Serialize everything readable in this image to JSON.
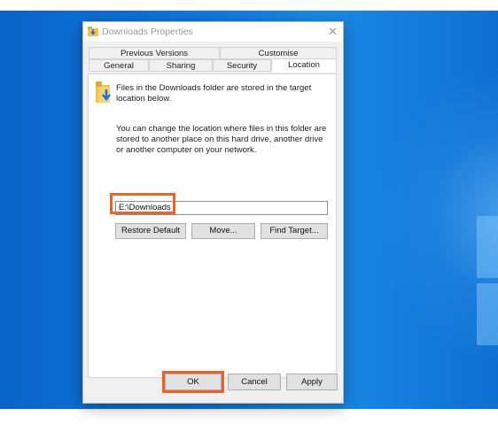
{
  "window": {
    "title": "Downloads Properties",
    "close_glyph": "✕"
  },
  "tabs": {
    "row1": [
      "Previous Versions",
      "Customise"
    ],
    "row2": [
      "General",
      "Sharing",
      "Security",
      "Location"
    ],
    "active": "Location"
  },
  "location": {
    "intro": "Files in the Downloads folder are stored in the target location below.",
    "description": "You can change the location where files in this folder are stored to another place on this hard drive, another drive or another computer on your network.",
    "path_value": "E:\\Downloads",
    "restore_default": "Restore Default",
    "move": "Move...",
    "find_target": "Find Target..."
  },
  "footer": {
    "ok": "OK",
    "cancel": "Cancel",
    "apply": "Apply"
  },
  "colors": {
    "highlight": "#e8642c",
    "desktop": "#0f78de"
  },
  "icons": [
    "downloads-folder-icon",
    "close-icon"
  ]
}
